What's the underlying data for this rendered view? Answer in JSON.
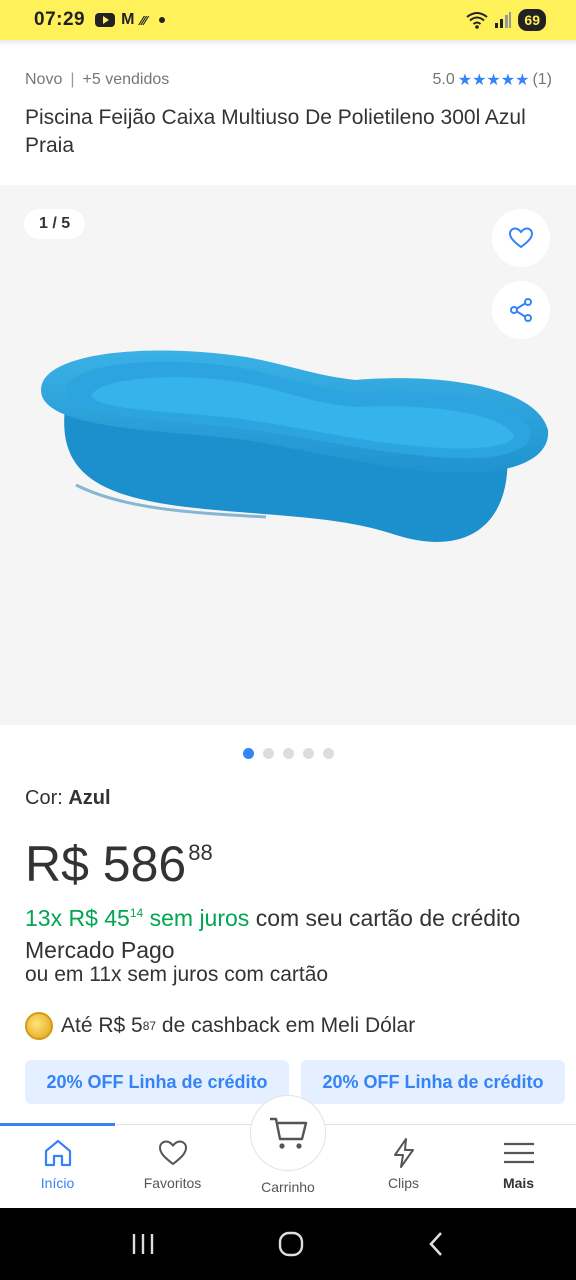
{
  "status_bar": {
    "time": "07:29",
    "battery": "69",
    "bg_color": "#fff159"
  },
  "product": {
    "condition": "Novo",
    "sold": "+5 vendidos",
    "rating_value": "5.0",
    "rating_stars": "★★★★★",
    "rating_count": "(1)",
    "title": "Piscina Feijão Caixa Multiuso De Polietileno 300l Azul Praia"
  },
  "gallery": {
    "counter": "1 / 5",
    "total_images": 5,
    "active_index": 0,
    "icons": [
      "heart-icon",
      "share-icon"
    ]
  },
  "color": {
    "label": "Cor:",
    "value": "Azul"
  },
  "price": {
    "currency_main": "R$ 586",
    "cents": "88"
  },
  "installments": {
    "green_prefix": "13x R$ 45",
    "green_cents": "14",
    "green_suffix": " sem juros",
    "rest": " com seu cartão de crédito Mercado Pago",
    "other": "ou em 11x sem juros com cartão"
  },
  "cashback": {
    "prefix": "Até R$ 5",
    "cents": "87",
    "suffix": " de cashback em Meli Dólar"
  },
  "promos": [
    "20% OFF Linha de crédito",
    "20% OFF Linha de crédito"
  ],
  "nav": {
    "items": [
      {
        "label": "Início",
        "icon": "home-icon"
      },
      {
        "label": "Favoritos",
        "icon": "heart-icon"
      },
      {
        "label": "Carrinho",
        "icon": "cart-icon"
      },
      {
        "label": "Clips",
        "icon": "lightning-icon"
      },
      {
        "label": "Mais",
        "icon": "menu-icon"
      }
    ]
  },
  "colors": {
    "accent": "#3483fa",
    "green": "#00a650",
    "yellow": "#fff159"
  }
}
